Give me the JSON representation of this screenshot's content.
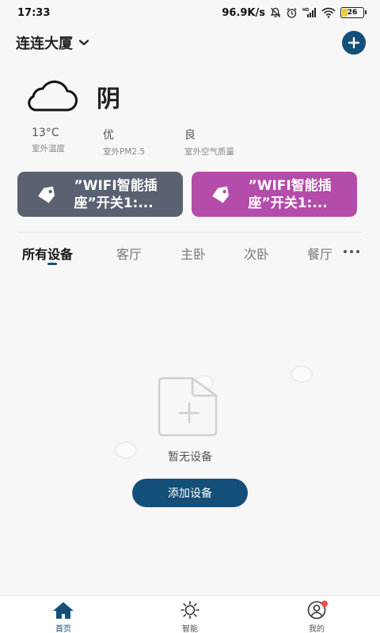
{
  "status_bar": {
    "time": "17:33",
    "network_speed": "96.9K/s",
    "signal_label": "HD",
    "battery": "26",
    "battery_level": 0.26
  },
  "header": {
    "location": "连连大厦",
    "add_icon": "plus-circle-icon"
  },
  "weather": {
    "icon": "cloud-icon",
    "condition": "阴",
    "metrics": [
      {
        "value": "13°C",
        "label": "室外温度"
      },
      {
        "value": "优",
        "label": "室外PM2.5"
      },
      {
        "value": "良",
        "label": "室外空气质量"
      }
    ]
  },
  "scenes": [
    {
      "text": "”WIFI智能插座”开关1:...",
      "color": "#5a6170",
      "icon": "tag-icon"
    },
    {
      "text": "”WIFI智能插座”开关1:...",
      "color": "#b44ca9",
      "icon": "tag-icon"
    }
  ],
  "tabs": [
    "所有设备",
    "客厅",
    "主卧",
    "次卧",
    "餐厅"
  ],
  "empty_state": {
    "message": "暂无设备",
    "button": "添加设备",
    "icon": "add-file-icon"
  },
  "bottom_nav": [
    {
      "label": "首页",
      "icon": "home-icon",
      "active": true
    },
    {
      "label": "智能",
      "icon": "sun-icon",
      "active": false
    },
    {
      "label": "我的",
      "icon": "user-icon",
      "active": false,
      "badge": true
    }
  ],
  "colors": {
    "primary": "#134f79",
    "badge": "#f04b4b"
  }
}
